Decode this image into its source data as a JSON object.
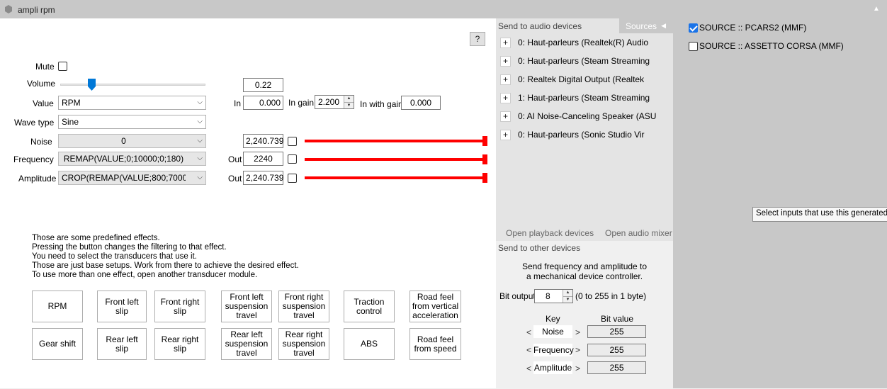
{
  "window": {
    "title": "ampli rpm",
    "collapse_glyph": "▲"
  },
  "help": {
    "label": "?"
  },
  "controls": {
    "mute_label": "Mute",
    "volume_label": "Volume",
    "volume_value": 0.22,
    "volume_display": "0.22",
    "value_label": "Value",
    "value_selected": "RPM",
    "wave_type_label": "Wave type",
    "wave_type_selected": "Sine",
    "noise_label": "Noise",
    "noise_combo": "0",
    "noise_out": "2,240.739",
    "frequency_label": "Frequency",
    "frequency_combo": "REMAP(VALUE;0;10000;0;180)",
    "frequency_out_label": "Out",
    "frequency_out": "2240",
    "amplitude_label": "Amplitude",
    "amplitude_combo": "CROP(REMAP(VALUE;800;7000;0...",
    "amplitude_out_label": "Out",
    "amplitude_out": "2,240.739",
    "in_label": "In",
    "in_value": "0.000",
    "in_gain_label": "In gain",
    "in_gain_value": "2.200",
    "in_with_gain_label": "In with gain",
    "in_with_gain_value": "0.000"
  },
  "description": [
    "Those are some predefined effects.",
    "Pressing the button changes the filtering to that effect.",
    "You need to select the transducers that use it.",
    "Those are just base setups. Work from there to achieve the desired effect.",
    "To use more than one effect, open another transducer module."
  ],
  "effects": {
    "rpm": "RPM",
    "front_left_slip": "Front left slip",
    "front_right_slip": "Front right slip",
    "front_left_susp": "Front left suspension travel",
    "front_right_susp": "Front right suspension travel",
    "traction": "Traction control",
    "road_vertical": "Road feel from vertical acceleration",
    "gear_shift": "Gear shift",
    "rear_left_slip": "Rear left slip",
    "rear_right_slip": "Rear right slip",
    "rear_left_susp": "Rear left suspension travel",
    "rear_right_susp": "Rear right suspension travel",
    "abs": "ABS",
    "road_speed": "Road feel from speed"
  },
  "audio": {
    "header": "Send to audio devices",
    "sources_tab": "Sources",
    "plus": "+",
    "devices": [
      "0: Haut-parleurs (Realtek(R) Audio",
      "0: Haut-parleurs (Steam Streaming",
      "0: Realtek Digital Output (Realtek",
      "1: Haut-parleurs (Steam Streaming",
      "0: AI Noise-Canceling Speaker (ASU",
      "0: Haut-parleurs (Sonic Studio Vir"
    ],
    "open_playback": "Open playback devices",
    "open_mixer": "Open audio mixer"
  },
  "other": {
    "header": "Send to other devices",
    "desc_line1": "Send frequency and amplitude to",
    "desc_line2": "a mechanical device controller.",
    "bit_output_label": "Bit output",
    "bit_output_value": "8",
    "bit_output_hint": "(0 to 255 in 1 byte)",
    "key_header": "Key",
    "bit_value_header": "Bit value",
    "rows": [
      {
        "key": "Noise",
        "value": "255"
      },
      {
        "key": "Frequency",
        "value": "255"
      },
      {
        "key": "Amplitude",
        "value": "255"
      }
    ],
    "lt": "<",
    "gt": ">"
  },
  "sources": {
    "items": [
      {
        "label": "SOURCE :: PCARS2 (MMF)",
        "checked": true
      },
      {
        "label": "SOURCE :: ASSETTO CORSA (MMF)",
        "checked": false
      }
    ]
  },
  "tooltip": {
    "text": "Select inputs that use this generated"
  },
  "colors": {
    "accent_red": "#ff0000",
    "slider_blue": "#0078d7",
    "check_blue": "#1a73e8"
  }
}
